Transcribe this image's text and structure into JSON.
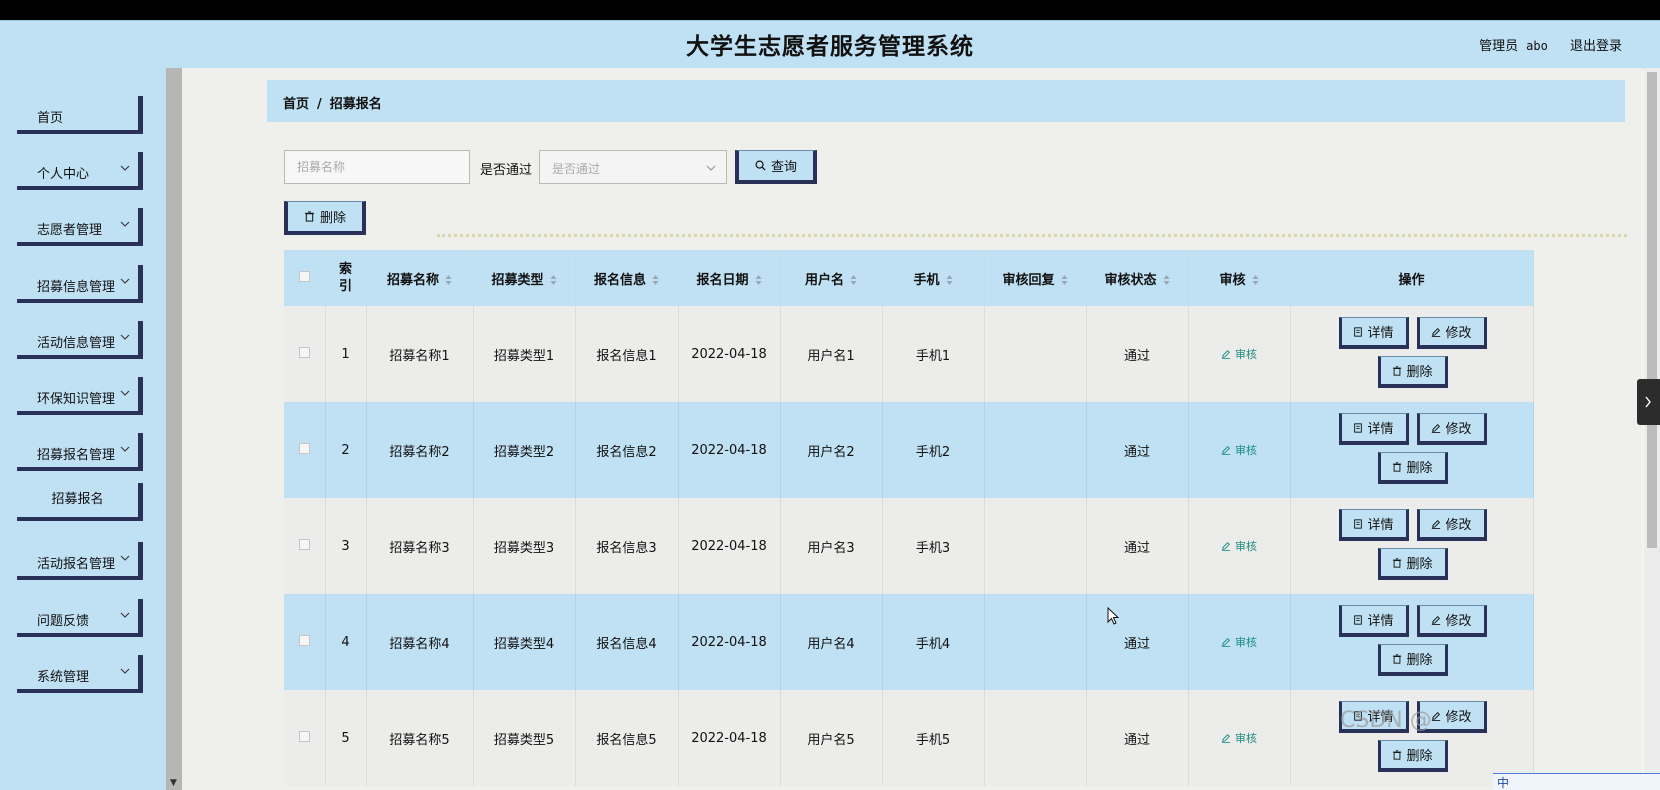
{
  "header": {
    "title": "大学生志愿者服务管理系统",
    "admin_label": "管理员",
    "admin_name": "abo",
    "logout": "退出登录"
  },
  "sidebar": {
    "items": [
      {
        "label": "首页",
        "has_arrow": false
      },
      {
        "label": "个人中心",
        "has_arrow": true
      },
      {
        "label": "志愿者管理",
        "has_arrow": true
      },
      {
        "label": "招募信息管理",
        "has_arrow": true
      },
      {
        "label": "活动信息管理",
        "has_arrow": true
      },
      {
        "label": "环保知识管理",
        "has_arrow": true
      },
      {
        "label": "招募报名管理",
        "has_arrow": true
      },
      {
        "label": "活动报名管理",
        "has_arrow": true
      },
      {
        "label": "问题反馈",
        "has_arrow": true
      },
      {
        "label": "系统管理",
        "has_arrow": true
      }
    ],
    "sub_item": "招募报名"
  },
  "breadcrumb": {
    "home": "首页",
    "separator": "/",
    "current": "招募报名"
  },
  "filters": {
    "name_placeholder": "招募名称",
    "passed_label": "是否通过",
    "passed_placeholder": "是否通过",
    "query_button": "查询",
    "bulk_delete_button": "删除"
  },
  "table": {
    "columns": [
      "索引",
      "招募名称",
      "招募类型",
      "报名信息",
      "报名日期",
      "用户名",
      "手机",
      "审核回复",
      "审核状态",
      "审核",
      "操作"
    ],
    "rows": [
      {
        "index": "1",
        "name": "招募名称1",
        "type": "招募类型1",
        "info": "报名信息1",
        "date": "2022-04-18",
        "user": "用户名1",
        "phone": "手机1",
        "reply": "",
        "status": "通过"
      },
      {
        "index": "2",
        "name": "招募名称2",
        "type": "招募类型2",
        "info": "报名信息2",
        "date": "2022-04-18",
        "user": "用户名2",
        "phone": "手机2",
        "reply": "",
        "status": "通过"
      },
      {
        "index": "3",
        "name": "招募名称3",
        "type": "招募类型3",
        "info": "报名信息3",
        "date": "2022-04-18",
        "user": "用户名3",
        "phone": "手机3",
        "reply": "",
        "status": "通过"
      },
      {
        "index": "4",
        "name": "招募名称4",
        "type": "招募类型4",
        "info": "报名信息4",
        "date": "2022-04-18",
        "user": "用户名4",
        "phone": "手机4",
        "reply": "",
        "status": "通过"
      },
      {
        "index": "5",
        "name": "招募名称5",
        "type": "招募类型5",
        "info": "报名信息5",
        "date": "2022-04-18",
        "user": "用户名5",
        "phone": "手机5",
        "reply": "",
        "status": "通过"
      }
    ],
    "review_link": "审核",
    "actions": {
      "detail": "详情",
      "edit": "修改",
      "delete": "删除"
    }
  },
  "watermark": "CSDN @",
  "ime": {
    "label": "中"
  },
  "colors": {
    "accent": "#bfe1f3",
    "button_border": "#2a3159",
    "review_link": "#1e8f80"
  },
  "icons": {
    "search": "search-icon",
    "delete": "trash-icon",
    "detail": "document-icon",
    "edit": "pencil-icon",
    "review": "pencil-icon",
    "expand": "chevron-right-icon"
  }
}
